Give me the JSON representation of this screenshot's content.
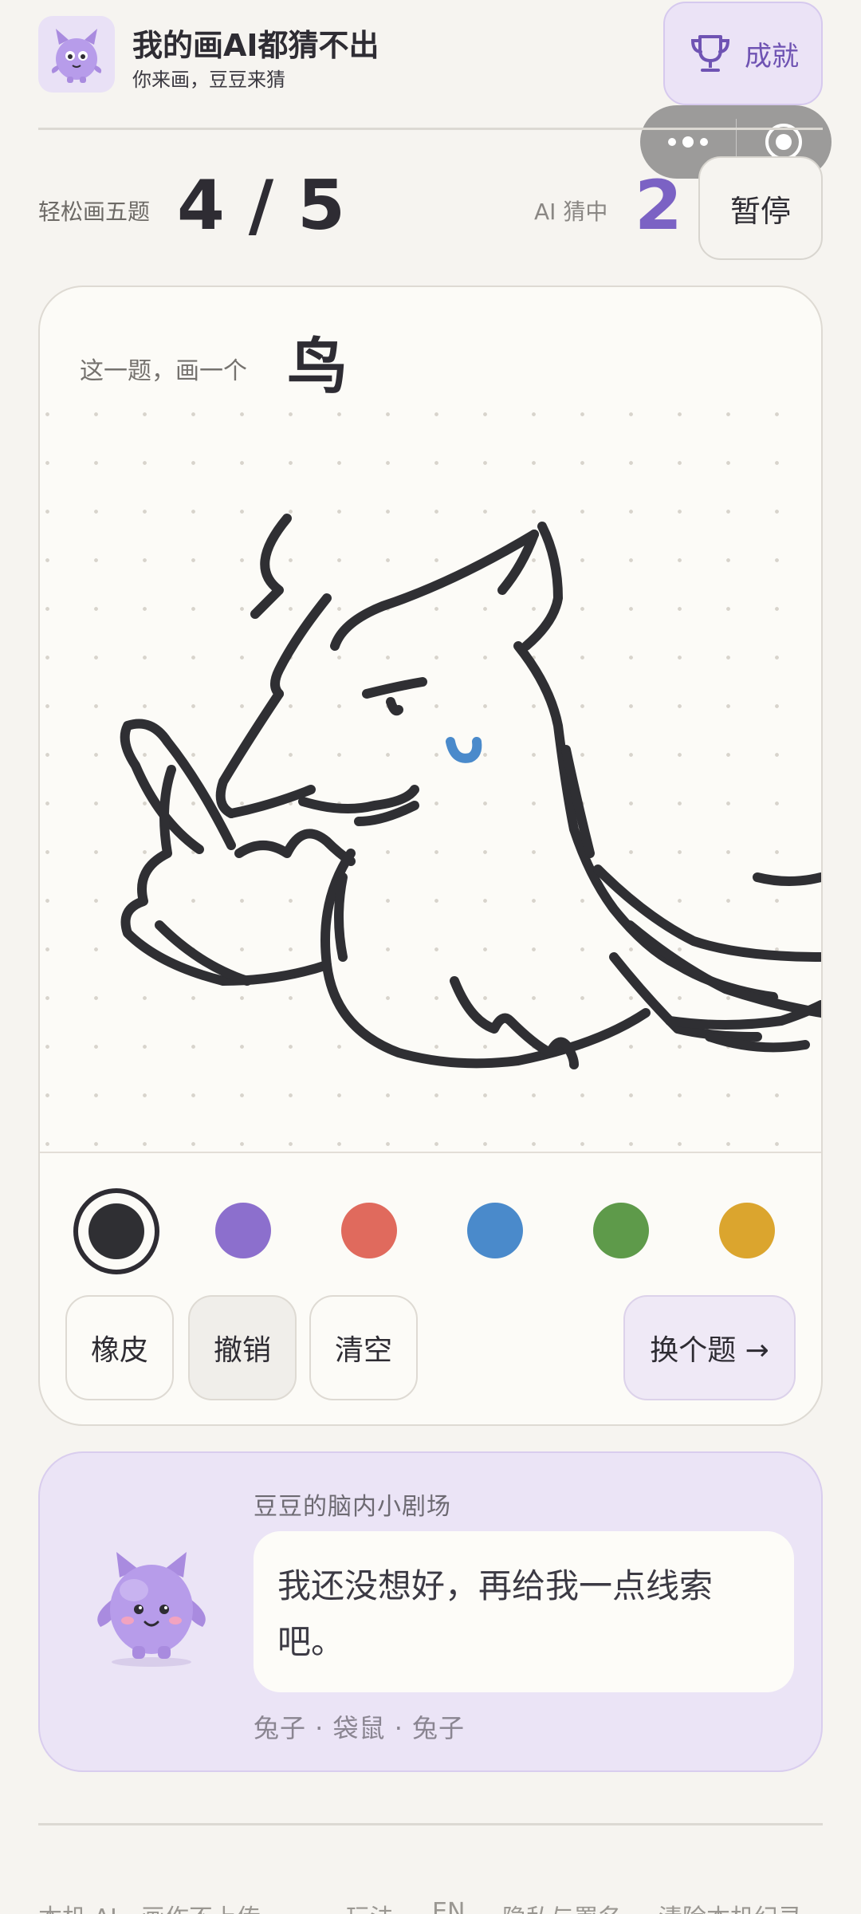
{
  "header": {
    "title": "我的画AI都猜不出",
    "subtitle": "你来画，豆豆来猜",
    "achievements_label": "成就"
  },
  "capsule": {
    "more_icon": "more-dots-icon",
    "close_icon": "target-circle-icon"
  },
  "score": {
    "round_label": "轻松画五题",
    "round_value": "4 / 5",
    "hit_label": "AI 猜中",
    "hit_value": "2",
    "pause_label": "暂停"
  },
  "prompt": {
    "label": "这一题，画一个",
    "word": "鸟"
  },
  "palette": {
    "colors": [
      "#2f2f33",
      "#8c6fcd",
      "#e06a5d",
      "#4a8acb",
      "#5e9a4a",
      "#dba52e"
    ],
    "selected": 0
  },
  "tools": {
    "eraser": "橡皮",
    "undo": "撤销",
    "clear": "清空",
    "next": "换个题 →"
  },
  "thoughts": {
    "title": "豆豆的脑内小剧场",
    "message": "我还没想好，再给我一点线索吧。",
    "guesses": "兔子 · 袋鼠 · 兔子"
  },
  "footer": {
    "items": [
      "本机 AI，画作不上传",
      "玩法",
      "EN",
      "隐私与署名",
      "清除本机纪录"
    ]
  }
}
